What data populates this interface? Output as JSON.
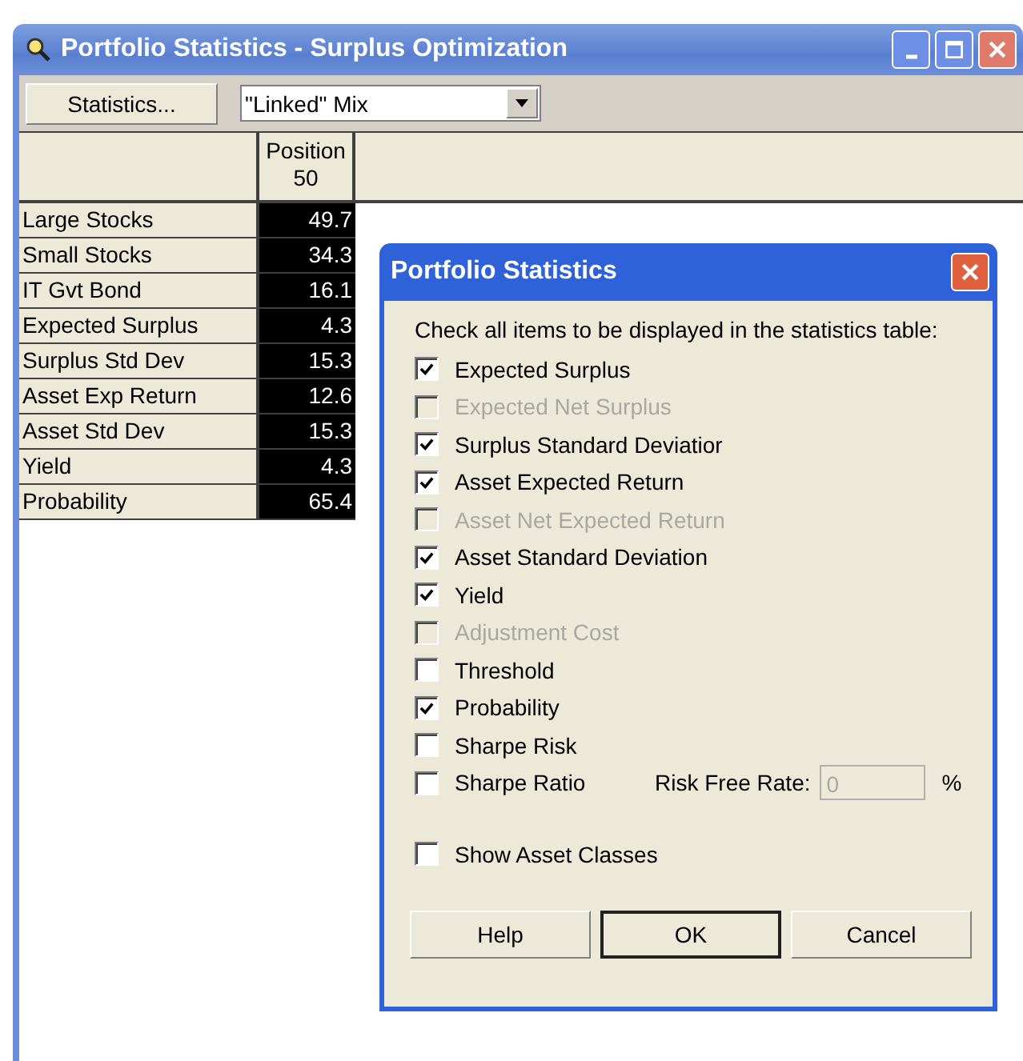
{
  "window": {
    "title": "Portfolio Statistics - Surplus Optimization"
  },
  "toolbar": {
    "statistics_button": "Statistics...",
    "mix_dropdown": "\"Linked\" Mix"
  },
  "table": {
    "column_header": {
      "line_1": "Position",
      "line_2": "50"
    },
    "rows": [
      {
        "label": "Large Stocks",
        "value": "49.7"
      },
      {
        "label": "Small Stocks",
        "value": "34.3"
      },
      {
        "label": "IT Gvt Bond",
        "value": "16.1"
      },
      {
        "label": "Expected Surplus",
        "value": "4.3"
      },
      {
        "label": "Surplus Std Dev",
        "value": "15.3"
      },
      {
        "label": "Asset Exp Return",
        "value": "12.6"
      },
      {
        "label": "Asset Std Dev",
        "value": "15.3"
      },
      {
        "label": "Yield",
        "value": "4.3"
      },
      {
        "label": "Probability",
        "value": "65.4"
      }
    ]
  },
  "dialog": {
    "title": "Portfolio Statistics",
    "instruction": "Check all items to be displayed in the statistics table:",
    "items": [
      {
        "label": "Expected Surplus",
        "checked": true,
        "disabled": false
      },
      {
        "label": "Expected Net Surplus",
        "checked": false,
        "disabled": true
      },
      {
        "label": "Surplus Standard Deviatior",
        "checked": true,
        "disabled": false
      },
      {
        "label": "Asset Expected Return",
        "checked": true,
        "disabled": false
      },
      {
        "label": "Asset Net Expected Return",
        "checked": false,
        "disabled": true
      },
      {
        "label": "Asset Standard Deviation",
        "checked": true,
        "disabled": false
      },
      {
        "label": "Yield",
        "checked": true,
        "disabled": false
      },
      {
        "label": "Adjustment Cost",
        "checked": false,
        "disabled": true
      },
      {
        "label": "Threshold",
        "checked": false,
        "disabled": false
      },
      {
        "label": "Probability",
        "checked": true,
        "disabled": false
      },
      {
        "label": "Sharpe Risk",
        "checked": false,
        "disabled": false
      },
      {
        "label": "Sharpe Ratio",
        "checked": false,
        "disabled": false,
        "rate": {
          "label": "Risk Free Rate:",
          "value": "0",
          "unit": "%",
          "disabled": true
        }
      }
    ],
    "show_asset_classes": {
      "label": "Show Asset Classes",
      "checked": false,
      "disabled": false
    },
    "buttons": [
      {
        "label": "Help",
        "default": false
      },
      {
        "label": "OK",
        "default": true
      },
      {
        "label": "Cancel",
        "default": false
      }
    ]
  }
}
